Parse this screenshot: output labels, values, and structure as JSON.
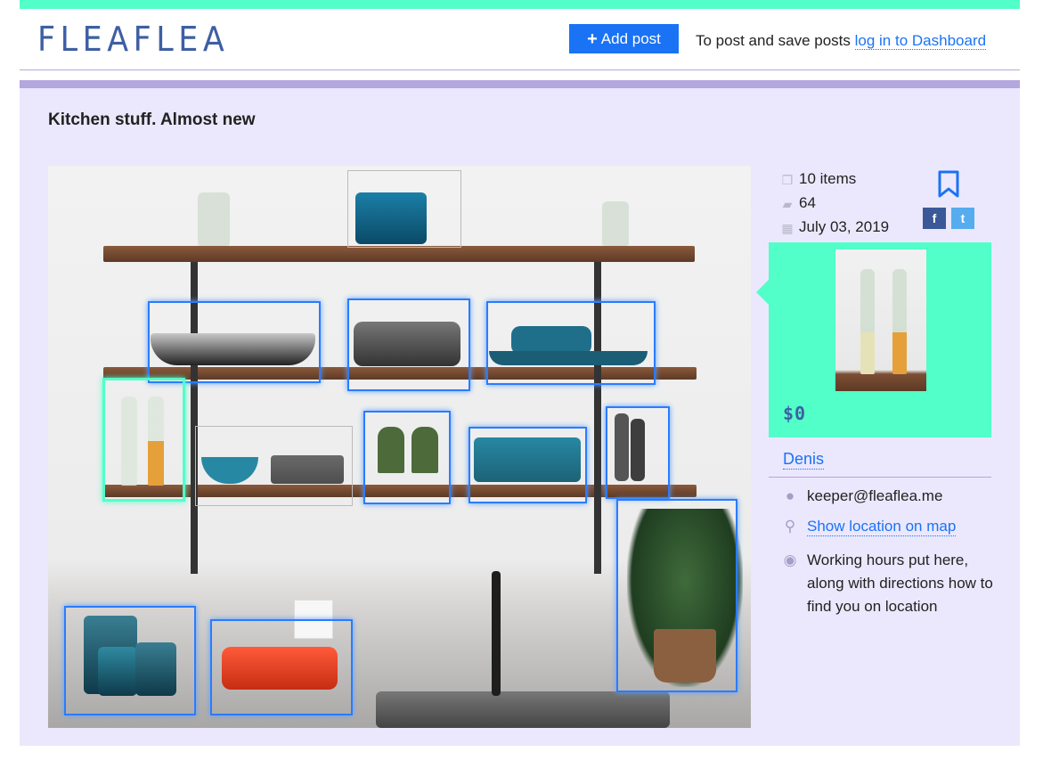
{
  "header": {
    "logo": "FLEAFLEA",
    "add_post_label": "Add post",
    "login_prompt": "To post and save posts",
    "login_link": "log in to Dashboard"
  },
  "post": {
    "title": "Kitchen stuff. Almost new",
    "items_count": "10 items",
    "views": "64",
    "date": "July 03, 2019",
    "selected_price": "$0",
    "owner": "Denis",
    "email": "keeper@fleaflea.me",
    "location_link": "Show location on map",
    "working_hours": "Working hours put here, along with directions how to find you on location"
  },
  "icons": {
    "items": "copy-icon",
    "views": "briefcase-icon",
    "date": "calendar-icon",
    "save": "bookmark-icon",
    "facebook": "facebook-icon",
    "twitter": "twitter-icon",
    "email": "comments-icon",
    "location": "map-marker-icon",
    "hours": "compass-icon"
  },
  "colors": {
    "accent_green": "#52ffc9",
    "accent_purple": "#b4a6de",
    "panel_bg": "#ebe8fd",
    "link_blue": "#1a73f5",
    "detection_blue": "#2b7bff",
    "facebook": "#3b5998",
    "twitter": "#55acee"
  }
}
